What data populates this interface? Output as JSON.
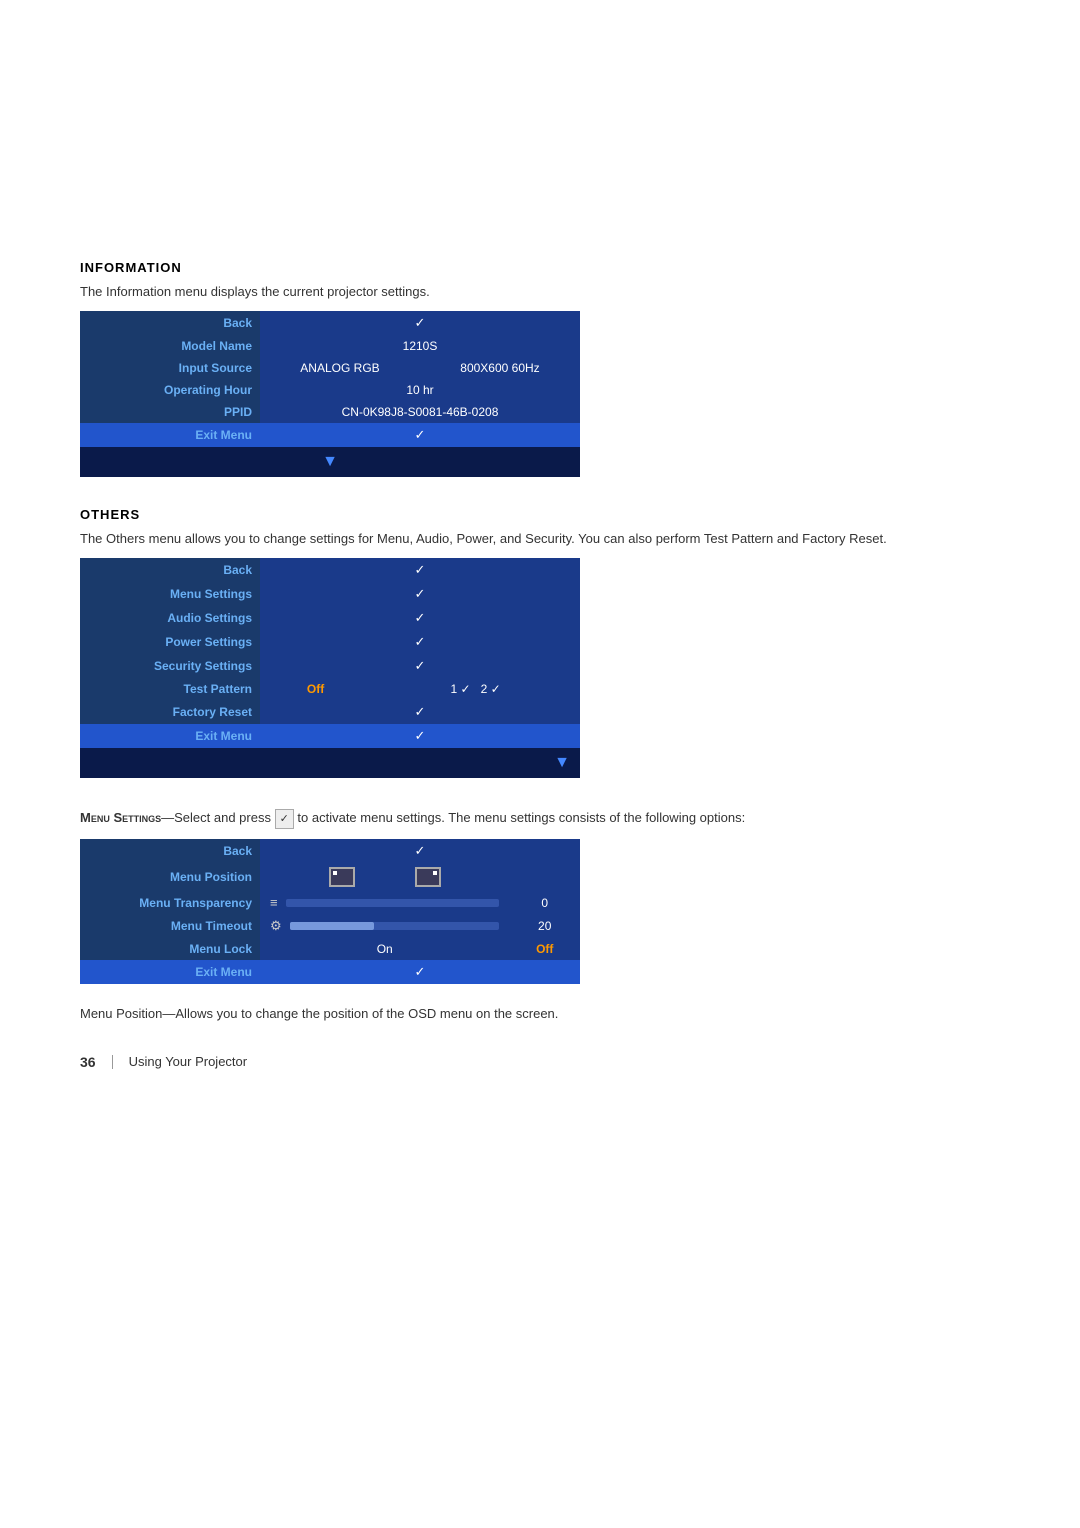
{
  "information": {
    "title": "INFORMATION",
    "description": "The Information menu displays the current projector settings.",
    "table_rows": [
      {
        "label": "Back",
        "col1": "✓",
        "col2": ""
      },
      {
        "label": "Model Name",
        "col1": "1210S",
        "col2": ""
      },
      {
        "label": "Input Source",
        "col1": "ANALOG RGB",
        "col2": "800X600 60Hz"
      },
      {
        "label": "Operating Hour",
        "col1": "10 hr",
        "col2": ""
      },
      {
        "label": "PPID",
        "col1": "CN-0K98J8-S0081-46B-0208",
        "col2": ""
      },
      {
        "label": "Exit Menu",
        "col1": "✓",
        "col2": ""
      }
    ]
  },
  "others": {
    "title": "OTHERS",
    "description": "The Others menu allows you to change settings for Menu, Audio, Power, and Security. You can also perform Test Pattern and Factory Reset.",
    "table_rows": [
      {
        "label": "Back",
        "col1": "✓",
        "col2": "",
        "col3": ""
      },
      {
        "label": "Menu Settings",
        "col1": "✓",
        "col2": "",
        "col3": ""
      },
      {
        "label": "Audio Settings",
        "col1": "✓",
        "col2": "",
        "col3": ""
      },
      {
        "label": "Power Settings",
        "col1": "✓",
        "col2": "",
        "col3": ""
      },
      {
        "label": "Security Settings",
        "col1": "✓",
        "col2": "",
        "col3": ""
      },
      {
        "label": "Test Pattern",
        "col1": "Off",
        "col2": "1 ✓",
        "col3": "2 ✓"
      },
      {
        "label": "Factory Reset",
        "col1": "✓",
        "col2": "",
        "col3": ""
      },
      {
        "label": "Exit Menu",
        "col1": "✓",
        "col2": "",
        "col3": ""
      }
    ]
  },
  "menu_settings": {
    "intro_bold": "Menu Settings",
    "intro_text": "—Select and press",
    "inline_check": "✓",
    "intro_text2": "to activate menu settings. The menu settings consists of the following options:",
    "table_rows": [
      {
        "label": "Back",
        "col1": "✓",
        "col2": ""
      },
      {
        "label": "Menu Position",
        "col1": "[icon1]",
        "col2": "[icon2]"
      },
      {
        "label": "Menu Transparency",
        "col1": "[slider]",
        "col2": "0"
      },
      {
        "label": "Menu Timeout",
        "col1": "[slider2]",
        "col2": "20"
      },
      {
        "label": "Menu Lock",
        "col1": "On",
        "col2": "Off"
      },
      {
        "label": "Exit Menu",
        "col1": "✓",
        "col2": ""
      }
    ]
  },
  "menu_position": {
    "bold": "Menu Position",
    "text": "—Allows you to change the position of the OSD menu on the screen."
  },
  "footer": {
    "page_number": "36",
    "separator": "|",
    "text": "Using Your Projector"
  }
}
